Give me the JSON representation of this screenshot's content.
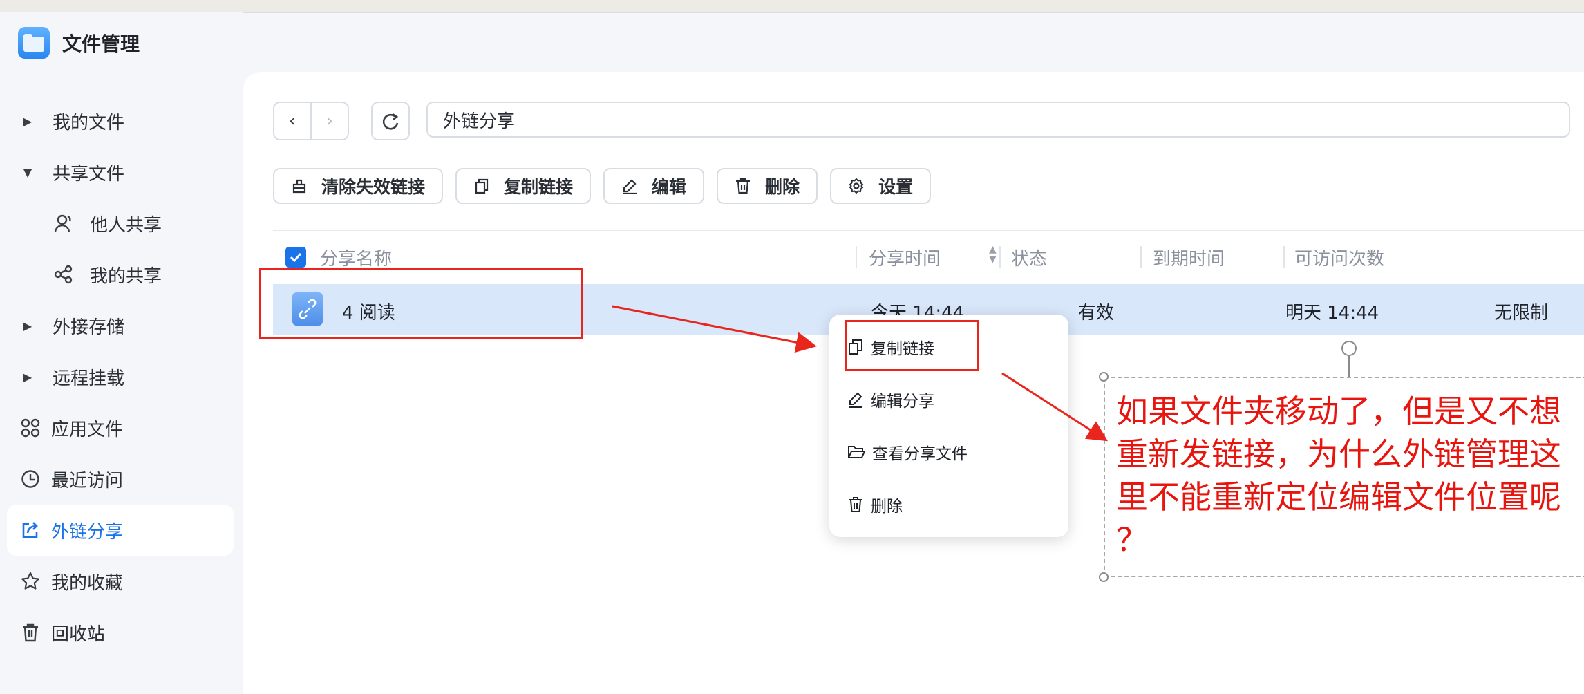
{
  "app": {
    "name": "文件管理"
  },
  "sidebar": {
    "items": [
      {
        "label": "我的文件",
        "icon": "caret-right-icon"
      },
      {
        "label": "共享文件",
        "icon": "caret-down-icon"
      },
      {
        "label": "他人共享",
        "icon": "user-icon"
      },
      {
        "label": "我的共享",
        "icon": "share-icon"
      },
      {
        "label": "外接存储",
        "icon": "caret-right-icon"
      },
      {
        "label": "远程挂载",
        "icon": "caret-right-icon"
      },
      {
        "label": "应用文件",
        "icon": "apps-icon"
      },
      {
        "label": "最近访问",
        "icon": "clock-icon"
      },
      {
        "label": "外链分享",
        "icon": "external-share-icon",
        "active": true
      },
      {
        "label": "我的收藏",
        "icon": "star-icon"
      },
      {
        "label": "回收站",
        "icon": "trash-icon"
      }
    ]
  },
  "toolbar": {
    "back": "‹",
    "forward": "›",
    "path": "外链分享"
  },
  "actions": {
    "clear_invalid": "清除失效链接",
    "copy_link": "复制链接",
    "edit": "编辑",
    "delete": "删除",
    "settings": "设置"
  },
  "table": {
    "columns": [
      "分享名称",
      "分享时间",
      "状态",
      "到期时间",
      "可访问次数"
    ],
    "rows": [
      {
        "name": "4 阅读",
        "time": "今天 14:44",
        "status": "有效",
        "expire": "明天 14:44",
        "visits": "无限制"
      }
    ]
  },
  "context_menu": {
    "items": [
      "复制链接",
      "编辑分享",
      "查看分享文件",
      "删除"
    ]
  },
  "annotation": {
    "lines": [
      "如果文件夹移动了，但是又不想",
      "重新发链接，为什么外链管理这",
      "里不能重新定位编辑文件位置呢",
      "？"
    ],
    "color": "#e8150e"
  },
  "colors": {
    "accent": "#1a73e8",
    "selected_row": "#d9e7fb",
    "annotation_red": "#e8261d"
  }
}
